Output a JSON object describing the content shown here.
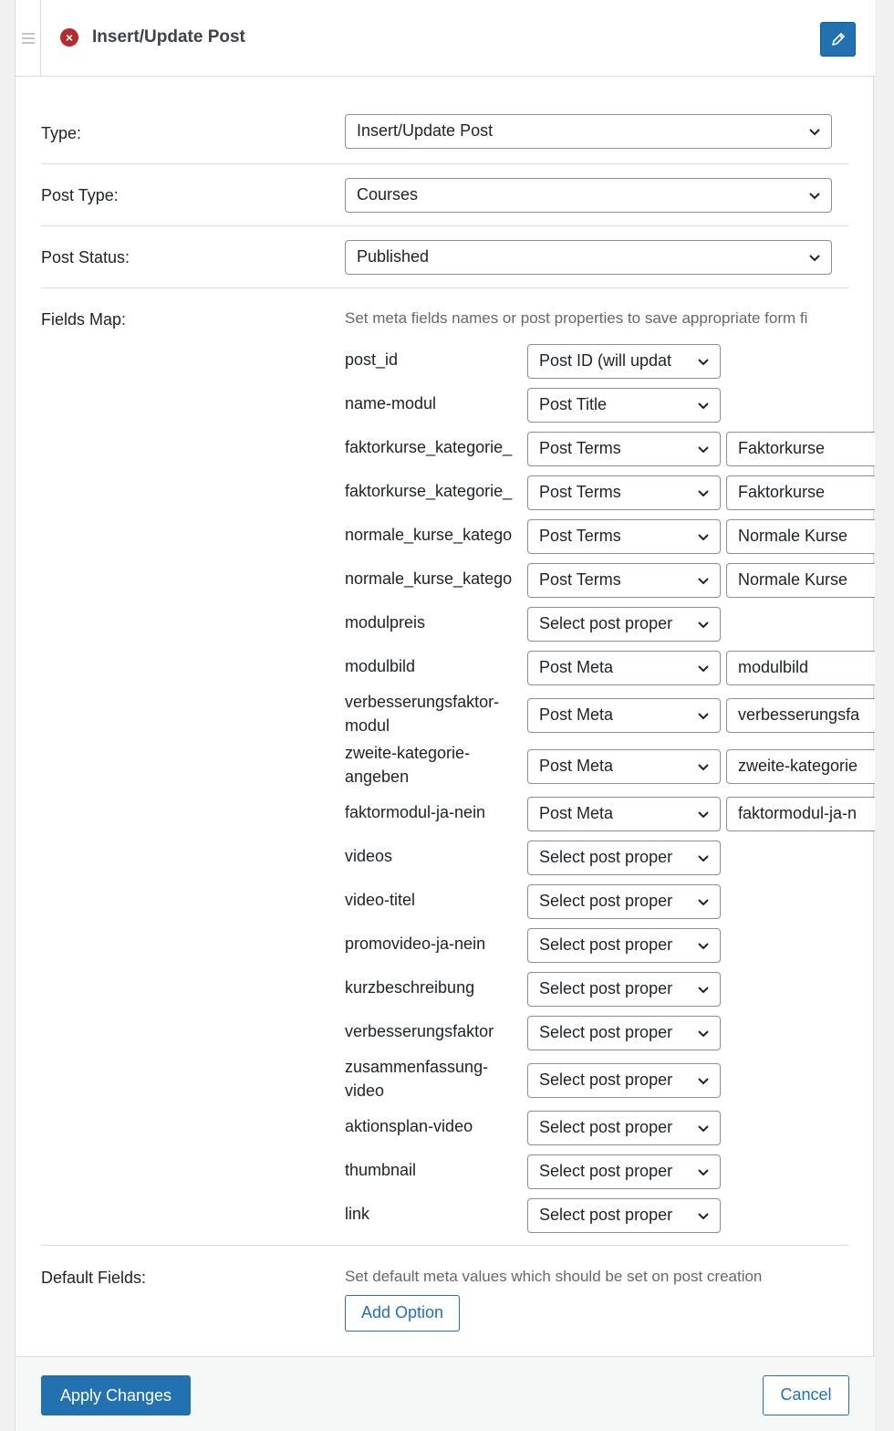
{
  "header": {
    "title": "Insert/Update Post"
  },
  "type": {
    "label": "Type:",
    "value": "Insert/Update Post"
  },
  "post_type": {
    "label": "Post Type:",
    "value": "Courses"
  },
  "post_status": {
    "label": "Post Status:",
    "value": "Published"
  },
  "fields_map": {
    "label": "Fields Map:",
    "description": "Set meta fields names or post properties to save appropriate form fi",
    "rows": [
      {
        "name": "post_id",
        "property": "Post ID (will updat",
        "meta": ""
      },
      {
        "name": "name-modul",
        "property": "Post Title",
        "meta": ""
      },
      {
        "name": "faktorkurse_kategorie_",
        "property": "Post Terms",
        "meta": "Faktorkurse"
      },
      {
        "name": "faktorkurse_kategorie_",
        "property": "Post Terms",
        "meta": "Faktorkurse"
      },
      {
        "name": "normale_kurse_katego",
        "property": "Post Terms",
        "meta": "Normale Kurse"
      },
      {
        "name": "normale_kurse_katego",
        "property": "Post Terms",
        "meta": "Normale Kurse"
      },
      {
        "name": "modulpreis",
        "property": "Select post proper",
        "meta": ""
      },
      {
        "name": "modulbild",
        "property": "Post Meta",
        "meta": "modulbild"
      },
      {
        "name": "verbesserungsfaktor-modul",
        "property": "Post Meta",
        "meta": "verbesserungsfa"
      },
      {
        "name": "zweite-kategorie-angeben",
        "property": "Post Meta",
        "meta": "zweite-kategorie"
      },
      {
        "name": "faktormodul-ja-nein",
        "property": "Post Meta",
        "meta": "faktormodul-ja-n"
      },
      {
        "name": "videos",
        "property": "Select post proper",
        "meta": ""
      },
      {
        "name": "video-titel",
        "property": "Select post proper",
        "meta": ""
      },
      {
        "name": "promovideo-ja-nein",
        "property": "Select post proper",
        "meta": ""
      },
      {
        "name": "kurzbeschreibung",
        "property": "Select post proper",
        "meta": ""
      },
      {
        "name": "verbesserungsfaktor",
        "property": "Select post proper",
        "meta": ""
      },
      {
        "name": "zusammenfassung-video",
        "property": "Select post proper",
        "meta": ""
      },
      {
        "name": "aktionsplan-video",
        "property": "Select post proper",
        "meta": ""
      },
      {
        "name": "thumbnail",
        "property": "Select post proper",
        "meta": ""
      },
      {
        "name": "link",
        "property": "Select post proper",
        "meta": ""
      }
    ]
  },
  "default_fields": {
    "label": "Default Fields:",
    "description": "Set default meta values which should be set on post creation",
    "add_option": "Add Option"
  },
  "footer": {
    "apply": "Apply Changes",
    "cancel": "Cancel"
  },
  "colors": {
    "accent": "#2271b1",
    "error": "#b32d2e",
    "border": "#8c8f94"
  }
}
